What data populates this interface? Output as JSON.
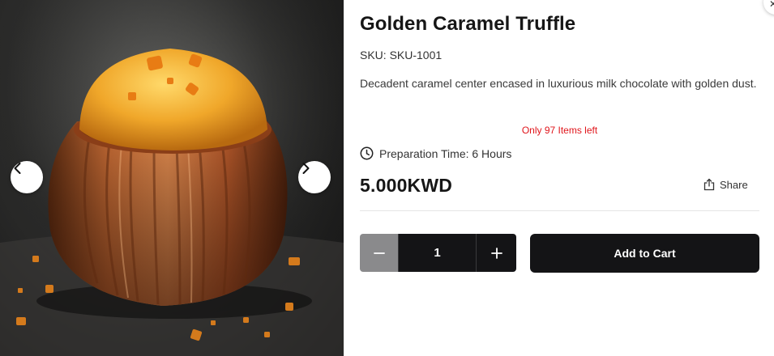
{
  "product": {
    "title": "Golden Caramel Truffle",
    "sku": "SKU: SKU-1001",
    "description": "Decadent caramel center encased in luxurious milk chocolate with golden dust.",
    "stock_notice": "Only 97 Items left",
    "preparation_time": "Preparation Time: 6 Hours",
    "price": "5.000KWD"
  },
  "actions": {
    "share_label": "Share",
    "quantity": "1",
    "add_to_cart_label": "Add to Cart"
  },
  "icons": {
    "prev": "chevron-left-icon",
    "next": "chevron-right-icon",
    "clock": "clock-icon",
    "share": "share-icon",
    "minus": "minus-icon",
    "plus": "plus-icon",
    "close": "close-icon"
  },
  "colors": {
    "stock_notice": "#e0151b",
    "button_dark": "#141416",
    "minus_button": "#8a8a8c"
  }
}
